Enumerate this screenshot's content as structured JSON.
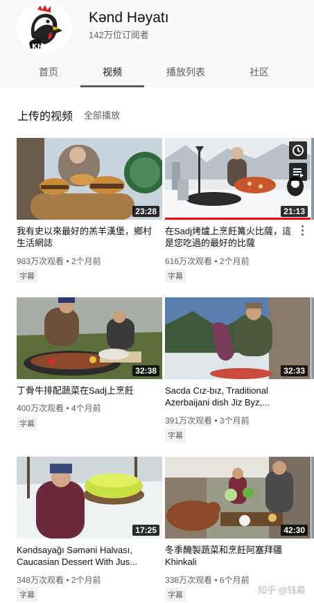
{
  "channel": {
    "name": "Kənd Həyatı",
    "subscribers": "142万位订阅者"
  },
  "tabs": [
    {
      "label": "首页",
      "active": false
    },
    {
      "label": "视频",
      "active": true
    },
    {
      "label": "播放列表",
      "active": false
    },
    {
      "label": "社区",
      "active": false
    }
  ],
  "section": {
    "title": "上传的视频",
    "play_all": "全部播放"
  },
  "videos": [
    {
      "title": "我有史以來最好的羔羊漢堡，鄉村生活網誌",
      "duration": "23:28",
      "views": "983万次观看",
      "age": "2个月前",
      "badge": "字幕"
    },
    {
      "title": "在Sadj烤爐上烹飪篝火比薩，這是您吃過的最好的比薩",
      "duration": "21:13",
      "views": "616万次观看",
      "age": "2个月前",
      "badge": "字幕"
    },
    {
      "title": "丁骨牛排配蔬菜在Sadj上烹飪",
      "duration": "32:38",
      "views": "400万次观看",
      "age": "4个月前",
      "badge": "字幕"
    },
    {
      "title": "Sacda Cız-bız, Traditional Azerbaijani dish Jiz Byz,...",
      "duration": "32:33",
      "views": "391万次观看",
      "age": "3个月前",
      "badge": "字幕"
    },
    {
      "title": "Kəndsayağı Səməni Halvası, Caucasian Dessert With Jus...",
      "duration": "17:25",
      "views": "348万次观看",
      "age": "2个月前",
      "badge": "字幕"
    },
    {
      "title": "冬季醃製蔬菜和烹飪阿塞拜疆Khinkali",
      "duration": "42:30",
      "views": "338万次观看",
      "age": "6个月前",
      "badge": "字幕"
    }
  ],
  "separator": " • ",
  "watermark": "知乎 @钱幕",
  "colors": {
    "header_bg": "#f9f9f9",
    "progress": "#ff0000",
    "meta_text": "#606060"
  },
  "icons": [
    "channel-logo-rooster",
    "clock-icon",
    "queue-icon",
    "more-vert-icon"
  ]
}
